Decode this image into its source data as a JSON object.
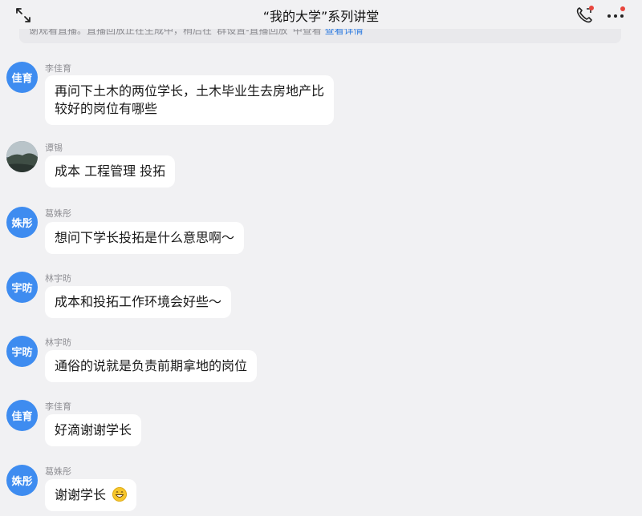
{
  "header": {
    "title": "“我的大学”系列讲堂"
  },
  "notice": {
    "text": "谢观看直播。直播回放正在生成中，稍后在“群设置-直播回放”中查看",
    "link": "查看详情"
  },
  "messages": [
    {
      "sender": "李佳育",
      "avatar": "佳育",
      "text": "再问下土木的两位学长，土木毕业生去房地产比",
      "text2": "较好的岗位有哪些"
    },
    {
      "sender": "谭锡",
      "avatar": "",
      "text": "成本 工程管理  投拓"
    },
    {
      "sender": "葛姝彤",
      "avatar": "姝彤",
      "text": "想问下学长投拓是什么意思啊～"
    },
    {
      "sender": "林宇昉",
      "avatar": "宇昉",
      "text": "成本和投拓工作环境会好些～"
    },
    {
      "sender": "林宇昉",
      "avatar": "宇昉",
      "text": "通俗的说就是负责前期拿地的岗位"
    },
    {
      "sender": "李佳育",
      "avatar": "佳育",
      "text": "好滴谢谢学长"
    },
    {
      "sender": "葛姝彤",
      "avatar": "姝彤",
      "text": "谢谢学长",
      "emoji": "grinning-emoji"
    }
  ],
  "colors": {
    "background": "#f1f1f3",
    "avatar_blue": "#3e8cf0",
    "link_blue": "#2f7ce0",
    "bubble": "#ffffff"
  },
  "icons": [
    "expand-icon",
    "phone-call-icon",
    "more-options-icon"
  ]
}
